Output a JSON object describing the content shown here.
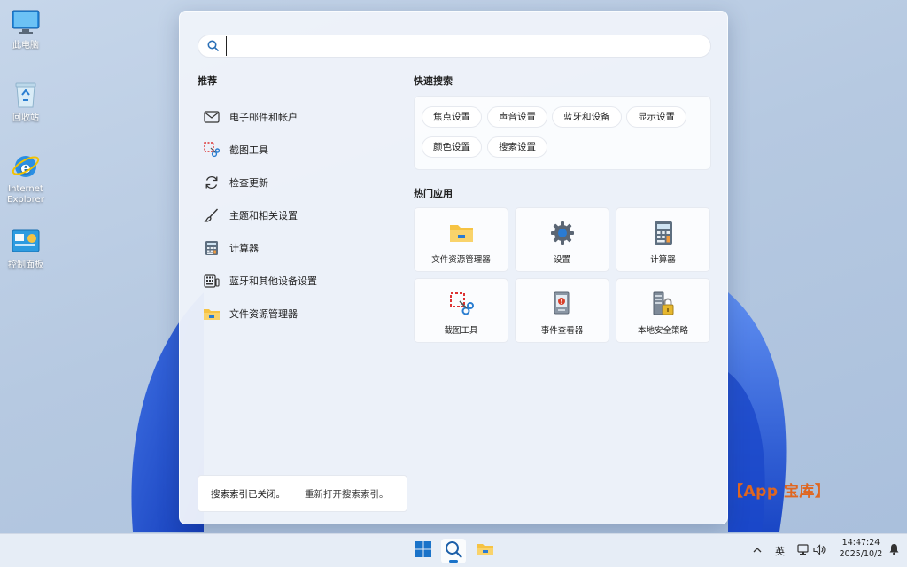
{
  "desktop": {
    "icons": [
      {
        "label": "此电脑",
        "icon": "monitor-icon"
      },
      {
        "label": "回收站",
        "icon": "recycle-bin-icon"
      },
      {
        "label": "Internet Explorer",
        "icon": "internet-explorer-icon"
      },
      {
        "label": "控制面板",
        "icon": "control-panel-icon"
      }
    ]
  },
  "search": {
    "value": "",
    "icon": "search-icon"
  },
  "recommended": {
    "title": "推荐",
    "items": [
      {
        "label": "电子邮件和帐户",
        "icon": "mail-icon"
      },
      {
        "label": "截图工具",
        "icon": "snipping-tool-icon"
      },
      {
        "label": "检查更新",
        "icon": "refresh-icon"
      },
      {
        "label": "主题和相关设置",
        "icon": "brush-icon"
      },
      {
        "label": "计算器",
        "icon": "calculator-icon"
      },
      {
        "label": "蓝牙和其他设备设置",
        "icon": "keyboard-devices-icon"
      },
      {
        "label": "文件资源管理器",
        "icon": "folder-icon"
      }
    ]
  },
  "quick_search": {
    "title": "快速搜索",
    "chips": [
      "焦点设置",
      "声音设置",
      "蓝牙和设备",
      "显示设置",
      "颜色设置",
      "搜索设置"
    ]
  },
  "top_apps": {
    "title": "热门应用",
    "apps": [
      {
        "label": "文件资源管理器",
        "icon": "folder-icon"
      },
      {
        "label": "设置",
        "icon": "gear-icon"
      },
      {
        "label": "计算器",
        "icon": "calculator-icon"
      },
      {
        "label": "截图工具",
        "icon": "snipping-tool-icon"
      },
      {
        "label": "事件查看器",
        "icon": "event-viewer-icon"
      },
      {
        "label": "本地安全策略",
        "icon": "security-policy-icon"
      }
    ]
  },
  "index_notice": {
    "text": "搜索索引已关闭。",
    "link": "重新打开搜索索引。"
  },
  "watermark": "【App 宝库】",
  "taskbar": {
    "apps": [
      "windows-start-icon",
      "search-icon",
      "file-explorer-icon"
    ],
    "tray": {
      "language": "英",
      "time": "14:47:24",
      "date": "2025/10/2"
    }
  },
  "colors": {
    "accent": "#1a73c9",
    "watermark": "#e0661f"
  }
}
